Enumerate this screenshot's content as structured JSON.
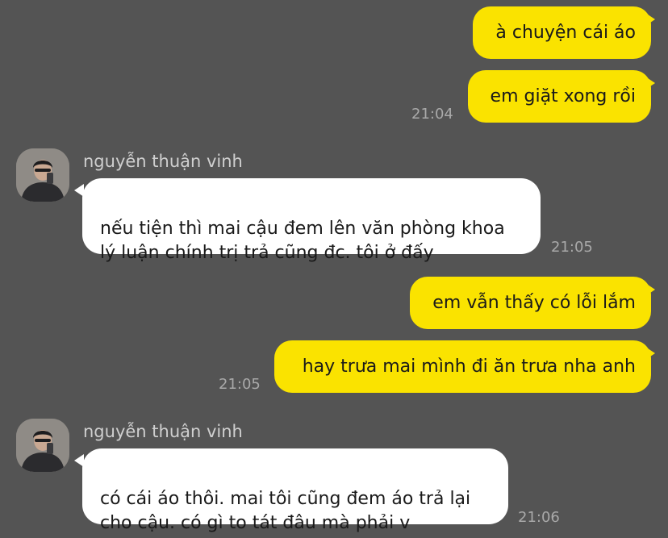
{
  "contact": {
    "name": "nguyễn thuận vinh"
  },
  "colors": {
    "background": "#545454",
    "outgoing_bubble": "#fae300",
    "incoming_bubble": "#ffffff",
    "timestamp": "#a9a9a9",
    "sender_name": "#cfcfcf"
  },
  "messages": [
    {
      "direction": "outgoing",
      "text": "à chuyện cái áo"
    },
    {
      "direction": "outgoing",
      "text": "em giặt xong rồi",
      "time": "21:04"
    },
    {
      "direction": "incoming",
      "sender": "nguyễn thuận vinh",
      "text": "nếu tiện thì mai cậu đem lên văn phòng khoa\nlý luận chính trị trả cũng đc. tôi ở đấy",
      "time": "21:05"
    },
    {
      "direction": "outgoing",
      "text": "em vẫn thấy có lỗi lắm"
    },
    {
      "direction": "outgoing",
      "text": "hay trưa mai mình đi ăn trưa nha anh",
      "time": "21:05"
    },
    {
      "direction": "incoming",
      "sender": "nguyễn thuận vinh",
      "text": "có cái áo thôi. mai tôi cũng đem áo trả lại\ncho cậu. có gì to tát đâu mà phải v",
      "time": "21:06"
    }
  ]
}
